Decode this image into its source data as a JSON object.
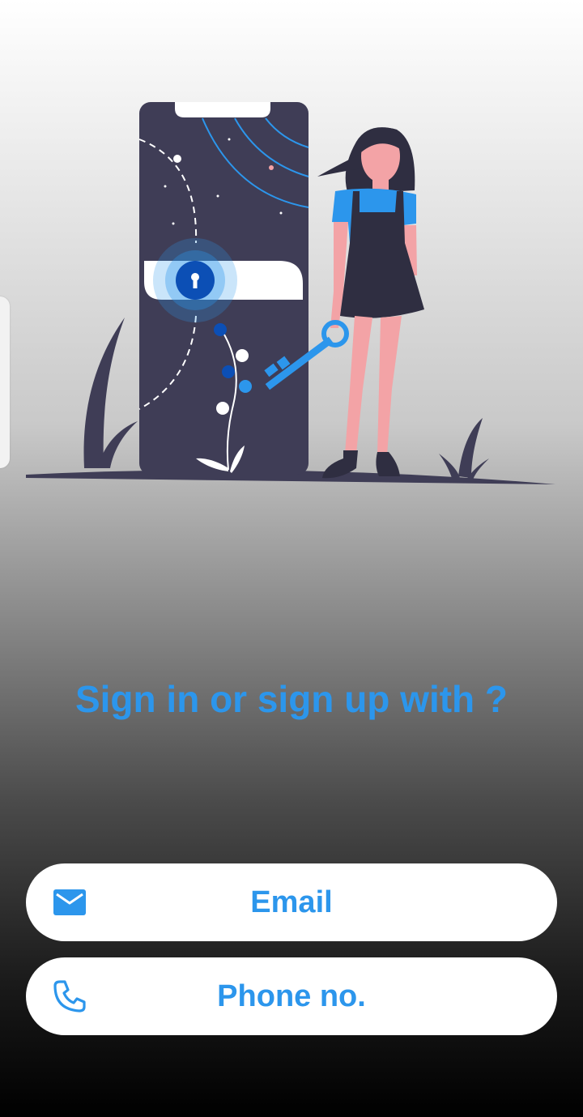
{
  "colors": {
    "accent": "#2c96ec",
    "button_bg": "#ffffff",
    "illustration_dark": "#3f3d56",
    "illustration_blue": "#2c96ec",
    "lock_blue": "#0c4fb5",
    "skin": "#f3a3a6"
  },
  "illustration": {
    "icon": "secure-login-illustration"
  },
  "prompt": {
    "text": "Sign in or sign up with ?"
  },
  "buttons": [
    {
      "id": "email",
      "label": "Email",
      "icon": "mail-icon"
    },
    {
      "id": "phone",
      "label": "Phone no.",
      "icon": "phone-icon"
    }
  ]
}
